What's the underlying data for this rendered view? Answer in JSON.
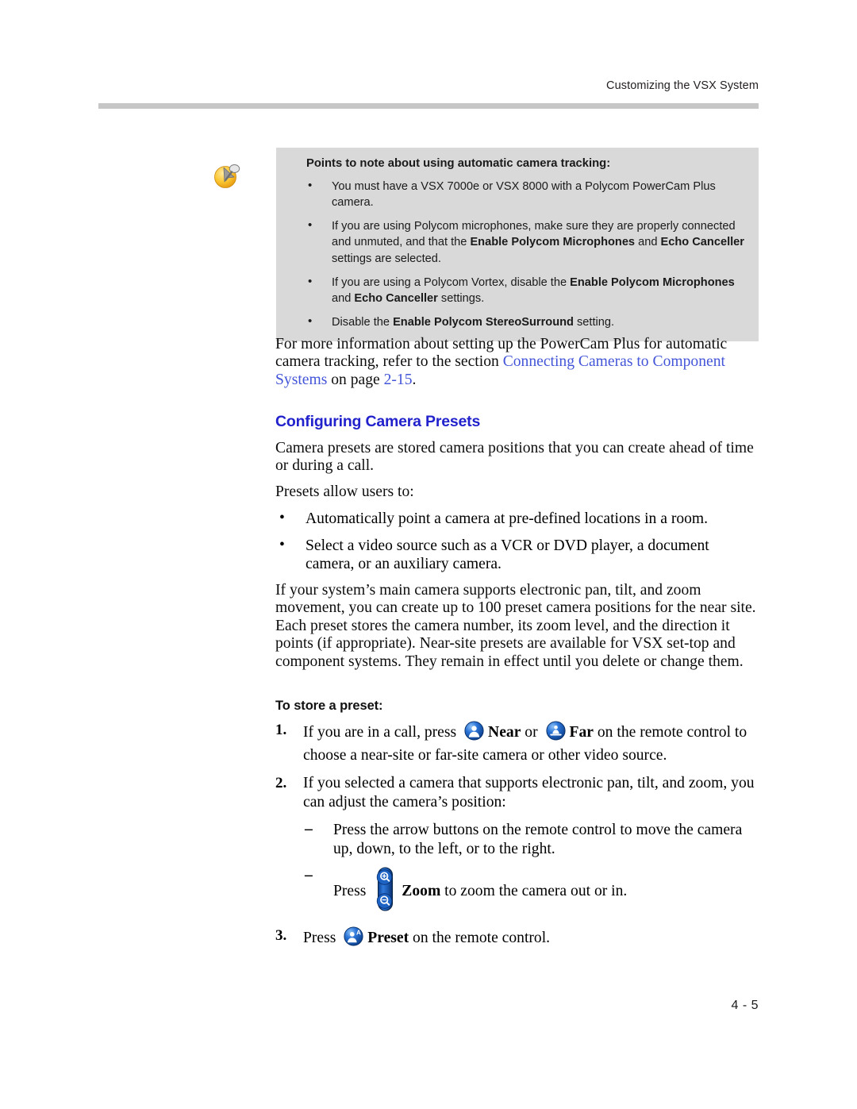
{
  "header": {
    "running_title": "Customizing the VSX System"
  },
  "note": {
    "icon": "note-pushpin-icon",
    "title": "Points to note about using automatic camera tracking:",
    "bullet_glyph": "•",
    "items": [
      [
        {
          "t": "You must have a VSX 7000e or VSX 8000 with a Polycom PowerCam Plus camera.",
          "b": false
        }
      ],
      [
        {
          "t": "If you are using Polycom microphones, make sure they are properly connected and unmuted, and that the ",
          "b": false
        },
        {
          "t": "Enable Polycom Microphones",
          "b": true
        },
        {
          "t": " and ",
          "b": false
        },
        {
          "t": "Echo Canceller",
          "b": true
        },
        {
          "t": " settings are selected.",
          "b": false
        }
      ],
      [
        {
          "t": "If you are using a Polycom Vortex, disable the ",
          "b": false
        },
        {
          "t": "Enable Polycom Microphones",
          "b": true
        },
        {
          "t": " and ",
          "b": false
        },
        {
          "t": "Echo Canceller",
          "b": true
        },
        {
          "t": " settings.",
          "b": false
        }
      ],
      [
        {
          "t": "Disable the ",
          "b": false
        },
        {
          "t": "Enable Polycom StereoSurround",
          "b": true
        },
        {
          "t": " setting.",
          "b": false
        }
      ]
    ]
  },
  "main": {
    "reference_paragraph": {
      "lead": "For more information about setting up the PowerCam Plus for automatic camera tracking, refer to the section ",
      "link_text": "Connecting Cameras to Component Systems",
      "middle": " on page ",
      "page_link": "2-15",
      "tail": "."
    },
    "section_heading": "Configuring Camera Presets",
    "paragraph_1": "Camera presets are stored camera positions that you can create ahead of time or during a call.",
    "paragraph_2": "Presets allow users to:",
    "bullet_glyph": "•",
    "bullets": [
      "Automatically point a camera at pre-defined locations in a room.",
      "Select a video source such as a VCR or DVD player, a document camera, or an auxiliary camera."
    ],
    "paragraph_3": "If your system’s main camera supports electronic pan, tilt, and zoom movement, you can create up to 100 preset camera positions for the near site. Each preset stores the camera number, its zoom level, and the direction it points (if appropriate). Near-site presets are available for VSX set-top and component systems. They remain in effect until you delete or change them.",
    "procedure_heading": "To store a preset:",
    "steps": [
      {
        "number": "1.",
        "parts": [
          {
            "t": "If you are in a call, press ",
            "b": false
          },
          {
            "icon": "remote-near-button-icon"
          },
          {
            "t": "Near",
            "b": true
          },
          {
            "t": " or ",
            "b": false
          },
          {
            "icon": "remote-far-button-icon"
          },
          {
            "t": "Far",
            "b": true
          },
          {
            "t": " on the remote control to choose a near-site or far-site camera or other video source.",
            "b": false
          }
        ]
      },
      {
        "number": "2.",
        "parts": [
          {
            "t": "If you selected a camera that supports electronic pan, tilt, and zoom, you can adjust the camera’s position:",
            "b": false
          }
        ],
        "dash_glyph": "–",
        "substeps": [
          {
            "parts": [
              {
                "t": "Press the arrow buttons on the remote control to move the camera up, down, to the left, or to the right.",
                "b": false
              }
            ]
          },
          {
            "parts": [
              {
                "t": "Press ",
                "b": false
              },
              {
                "icon": "remote-zoom-rocker-icon"
              },
              {
                "t": "Zoom",
                "b": true
              },
              {
                "t": " to zoom the camera out or in.",
                "b": false
              }
            ]
          }
        ]
      },
      {
        "number": "3.",
        "parts": [
          {
            "t": "Press ",
            "b": false
          },
          {
            "icon": "remote-preset-button-icon"
          },
          {
            "t": "Preset",
            "b": true
          },
          {
            "t": " on the remote control.",
            "b": false
          }
        ]
      }
    ]
  },
  "footer": {
    "page_number": "4 - 5"
  },
  "colors": {
    "link_blue": "#4355d8",
    "heading_blue": "#2222cc",
    "note_background": "#d9d9d9",
    "rule_gray": "#c6c6c6",
    "icon_blue": "#1a5fc4",
    "note_icon_yellow": "#f5c householder"
  }
}
